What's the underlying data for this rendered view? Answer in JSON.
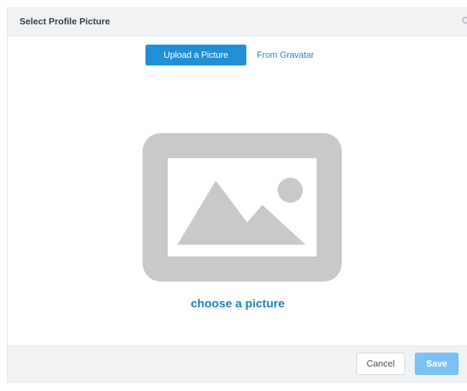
{
  "dialog": {
    "title": "Select Profile Picture",
    "close_icon": "close-icon"
  },
  "tabs": [
    {
      "label": "Upload a Picture",
      "active": true
    },
    {
      "label": "From Gravatar",
      "active": false
    }
  ],
  "upload": {
    "placeholder_icon": "image-placeholder-icon",
    "choose_link": "choose a picture"
  },
  "footer": {
    "cancel_label": "Cancel",
    "save_label": "Save"
  },
  "colors": {
    "accent": "#1f8fd6",
    "link": "#1f7fc0",
    "save_disabled": "#7cc1f1",
    "placeholder_gray": "#c9c9c9"
  }
}
